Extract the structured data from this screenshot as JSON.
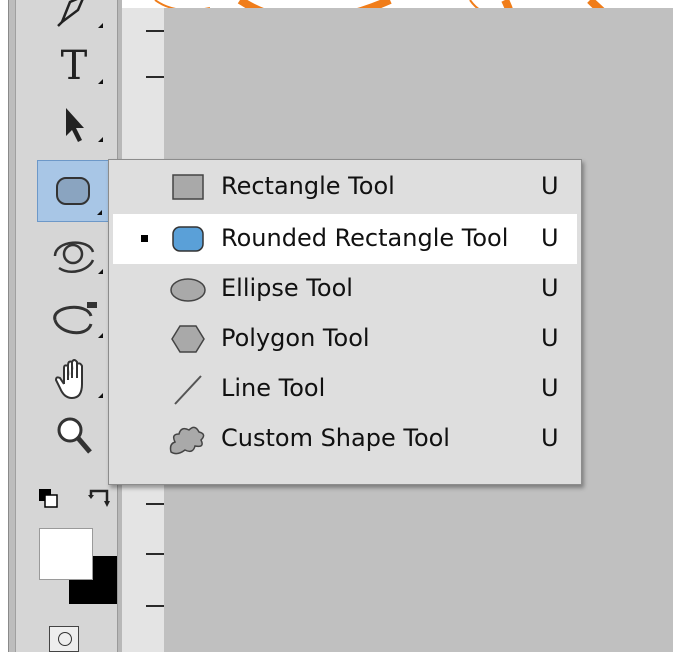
{
  "toolbar": {
    "tools": [
      {
        "name": "pen-tool",
        "icon": "pen-icon"
      },
      {
        "name": "type-tool",
        "icon": "type-t-icon",
        "glyph": "T"
      },
      {
        "name": "path-selection-tool",
        "icon": "arrow-select-icon"
      },
      {
        "name": "shape-tool",
        "icon": "rounded-rectangle-icon",
        "active": true
      },
      {
        "name": "3d-rotate-tool",
        "icon": "3d-rotate-icon"
      },
      {
        "name": "3d-orbit-tool",
        "icon": "3d-orbit-icon"
      },
      {
        "name": "hand-tool",
        "icon": "hand-icon"
      },
      {
        "name": "zoom-tool",
        "icon": "magnifier-icon"
      }
    ],
    "colors": {
      "foreground": "#ffffff",
      "background": "#000000"
    }
  },
  "flyout_menu": {
    "items": [
      {
        "label": "Rectangle Tool",
        "shortcut": "U",
        "icon": "rectangle-icon",
        "selected": false
      },
      {
        "label": "Rounded Rectangle Tool",
        "shortcut": "U",
        "icon": "rounded-rectangle-icon",
        "selected": true
      },
      {
        "label": "Ellipse Tool",
        "shortcut": "U",
        "icon": "ellipse-icon",
        "selected": false
      },
      {
        "label": "Polygon Tool",
        "shortcut": "U",
        "icon": "polygon-icon",
        "selected": false
      },
      {
        "label": "Line Tool",
        "shortcut": "U",
        "icon": "line-icon",
        "selected": false
      },
      {
        "label": "Custom Shape Tool",
        "shortcut": "U",
        "icon": "custom-shape-icon",
        "selected": false
      }
    ]
  },
  "theme": {
    "accent": "#a8c6e6",
    "selected_icon_fill": "#5aa0d8",
    "decoration": "#f07d1a"
  }
}
